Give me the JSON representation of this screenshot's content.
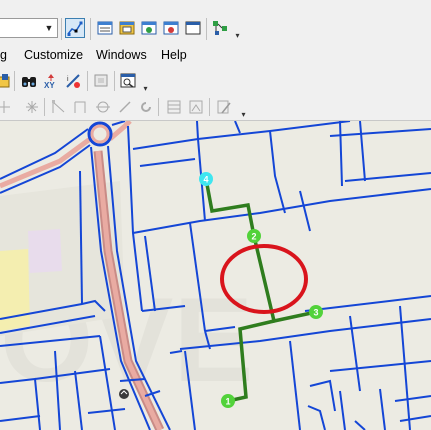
{
  "menubar": {
    "items": [
      {
        "label": "g"
      },
      {
        "label": "Customize"
      },
      {
        "label": "Windows"
      },
      {
        "label": "Help"
      }
    ]
  },
  "toolbar_top": {
    "combo_value": "",
    "icons": [
      "edit-tool-icon",
      "attributes-icon",
      "sketch-properties-icon",
      "create-features-icon",
      "table-icon",
      "window-icon",
      "topology-icon"
    ]
  },
  "toolbar_second": {
    "icons": [
      "add-data-icon",
      "find-icon",
      "go-to-xy-icon",
      "measure-icon",
      "identify-icon"
    ]
  },
  "toolbar_third": {
    "icons": [
      "move-icon",
      "explode-icon",
      "reshape-icon",
      "split-icon",
      "rotate-icon",
      "intersect-icon",
      "trace-icon",
      "table-grid-icon",
      "georeference-icon",
      "edit-vertices-icon"
    ]
  },
  "map": {
    "nodes": [
      {
        "label": "1",
        "color": "#52d23a"
      },
      {
        "label": "2",
        "color": "#52d23a"
      },
      {
        "label": "3",
        "color": "#52d23a"
      },
      {
        "label": "4",
        "color": "#3fe6f0"
      }
    ],
    "colors": {
      "parcel_lines": "#1446d6",
      "route": "#2f7d1e",
      "highlight_ring": "#d9141c",
      "background": "#ecebe3"
    }
  }
}
